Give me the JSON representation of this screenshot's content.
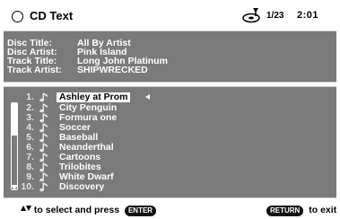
{
  "header": {
    "title": "CD Text",
    "track_indicator": "1/23",
    "time": "2:01",
    "title_icon": "circle-icon",
    "disc_icon": "disc-icon"
  },
  "info": {
    "disc_title_label": "Disc Title:",
    "disc_title": "All By Artist",
    "disc_artist_label": "Disc Artist:",
    "disc_artist": "Pink Island",
    "track_title_label": "Track Title:",
    "track_title": "Long John Platinum",
    "track_artist_label": "Track Artist:",
    "track_artist": "SHIPWRECKED"
  },
  "tracks": [
    {
      "num": "1.",
      "name": "Ashley at Prom"
    },
    {
      "num": "2.",
      "name": "City Penguin"
    },
    {
      "num": "3.",
      "name": "Formura one"
    },
    {
      "num": "4.",
      "name": "Soccer"
    },
    {
      "num": "5.",
      "name": "Baseball"
    },
    {
      "num": "6.",
      "name": "Neanderthal"
    },
    {
      "num": "7.",
      "name": "Cartoons"
    },
    {
      "num": "8.",
      "name": "Trilobites"
    },
    {
      "num": "9.",
      "name": "White Dwarf"
    },
    {
      "num": "10.",
      "name": "Discovery"
    }
  ],
  "selected_track_index": 0,
  "footer": {
    "select_text": "to select and press",
    "enter_key": "ENTER",
    "return_key": "RETURN",
    "exit_text": "to exit"
  },
  "colors": {
    "panel_bg": "#7a7a7a",
    "text": "#ffffff",
    "highlight_bg": "#ffffff",
    "highlight_text": "#000000"
  }
}
